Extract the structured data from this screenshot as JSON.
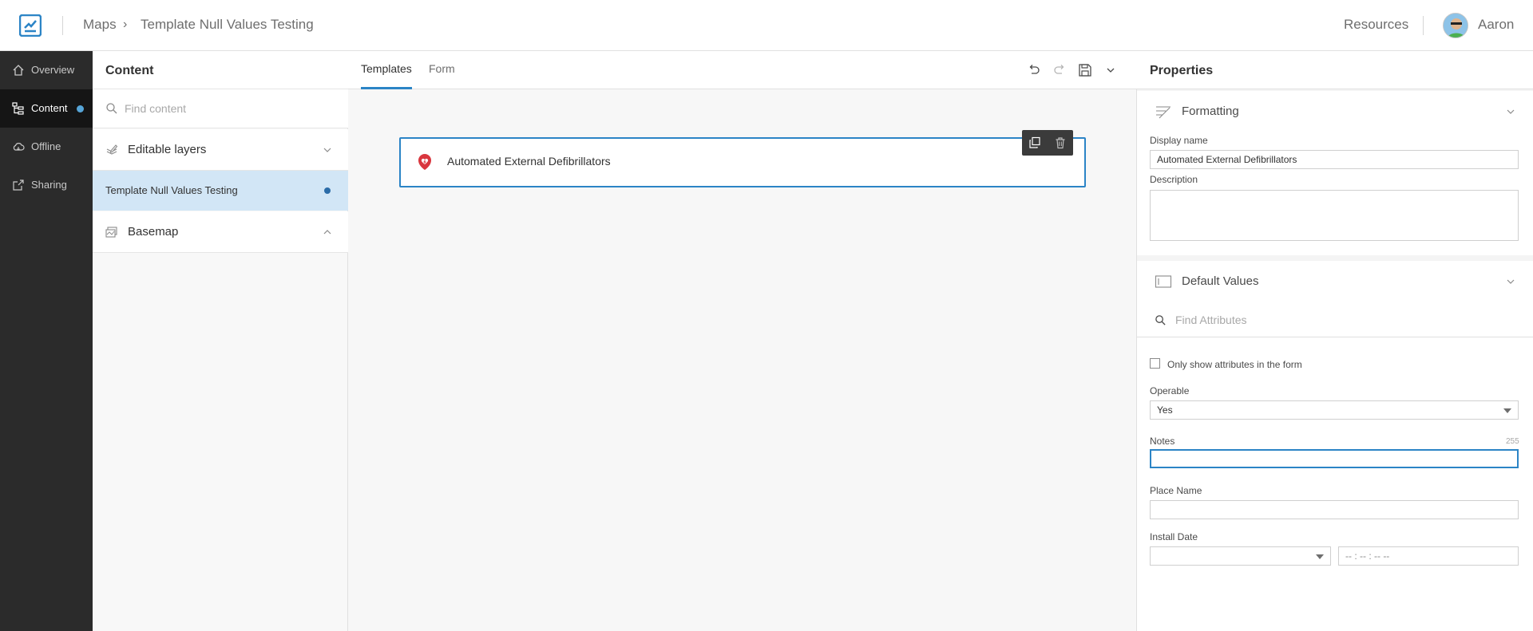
{
  "header": {
    "breadcrumb_root": "Maps",
    "breadcrumb_separator": "›",
    "map_title": "Template Null Values Testing",
    "resources_label": "Resources",
    "user_name": "Aaron"
  },
  "nav": {
    "items": [
      {
        "label": "Overview",
        "icon": "home-icon"
      },
      {
        "label": "Content",
        "icon": "content-tree-icon",
        "active": true
      },
      {
        "label": "Offline",
        "icon": "cloud-icon"
      },
      {
        "label": "Sharing",
        "icon": "share-icon"
      }
    ]
  },
  "content_panel": {
    "title": "Content",
    "search_placeholder": "Find content",
    "editable_layers_label": "Editable layers",
    "layer_name": "Template Null Values Testing",
    "basemap_label": "Basemap"
  },
  "center": {
    "tabs": [
      {
        "label": "Templates",
        "active": true
      },
      {
        "label": "Form",
        "active": false
      }
    ],
    "template_card": {
      "title": "Automated External Defibrillators",
      "icon": "aed-heart-icon"
    }
  },
  "properties": {
    "title": "Properties",
    "formatting": {
      "label": "Formatting",
      "display_name_label": "Display name",
      "display_name_value": "Automated External Defibrillators",
      "description_label": "Description",
      "description_value": ""
    },
    "default_values": {
      "label": "Default Values",
      "search_placeholder": "Find Attributes",
      "only_show_label": "Only show attributes in the form",
      "operable_label": "Operable",
      "operable_value": "Yes",
      "notes_label": "Notes",
      "notes_counter": "255",
      "notes_value": "",
      "place_name_label": "Place Name",
      "place_name_value": "",
      "install_date_label": "Install Date",
      "install_date_value": "",
      "install_time_placeholder": "-- : -- : --  --"
    }
  },
  "colors": {
    "accent": "#2b84c6",
    "nav_bg": "#2b2b2b",
    "selected_row": "#d2e6f6",
    "aed_red": "#d9363e"
  }
}
